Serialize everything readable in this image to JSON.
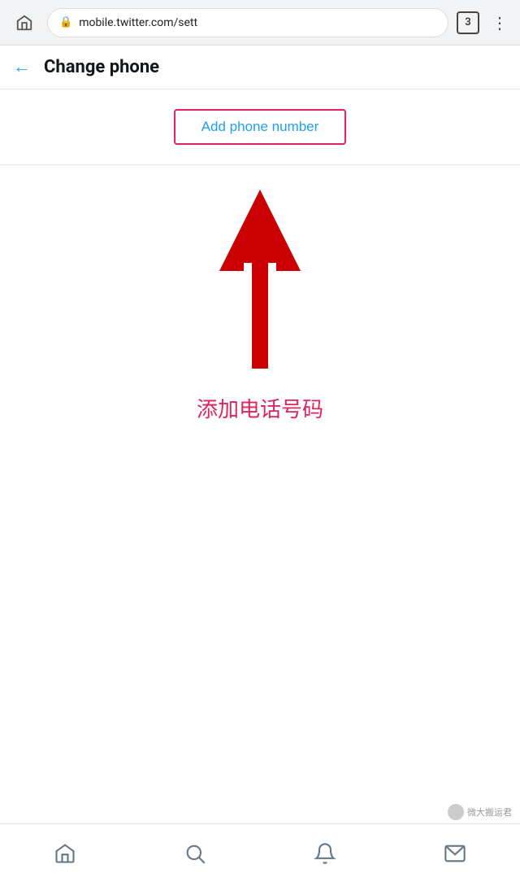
{
  "browser": {
    "url": "mobile.twitter.com/sett",
    "tab_count": "3",
    "lock_symbol": "🔒",
    "home_symbol": "⌂",
    "menu_dots": "⋮"
  },
  "header": {
    "title": "Change phone",
    "back_arrow": "←"
  },
  "content": {
    "add_phone_btn_label": "Add phone number"
  },
  "annotation": {
    "chinese_text": "添加电话号码"
  },
  "bottom_nav": {
    "home_icon": "⊙",
    "search_icon": "⌕",
    "bell_icon": "🔔",
    "mail_icon": "✉"
  },
  "watermark": {
    "text": "微大搬运君"
  }
}
